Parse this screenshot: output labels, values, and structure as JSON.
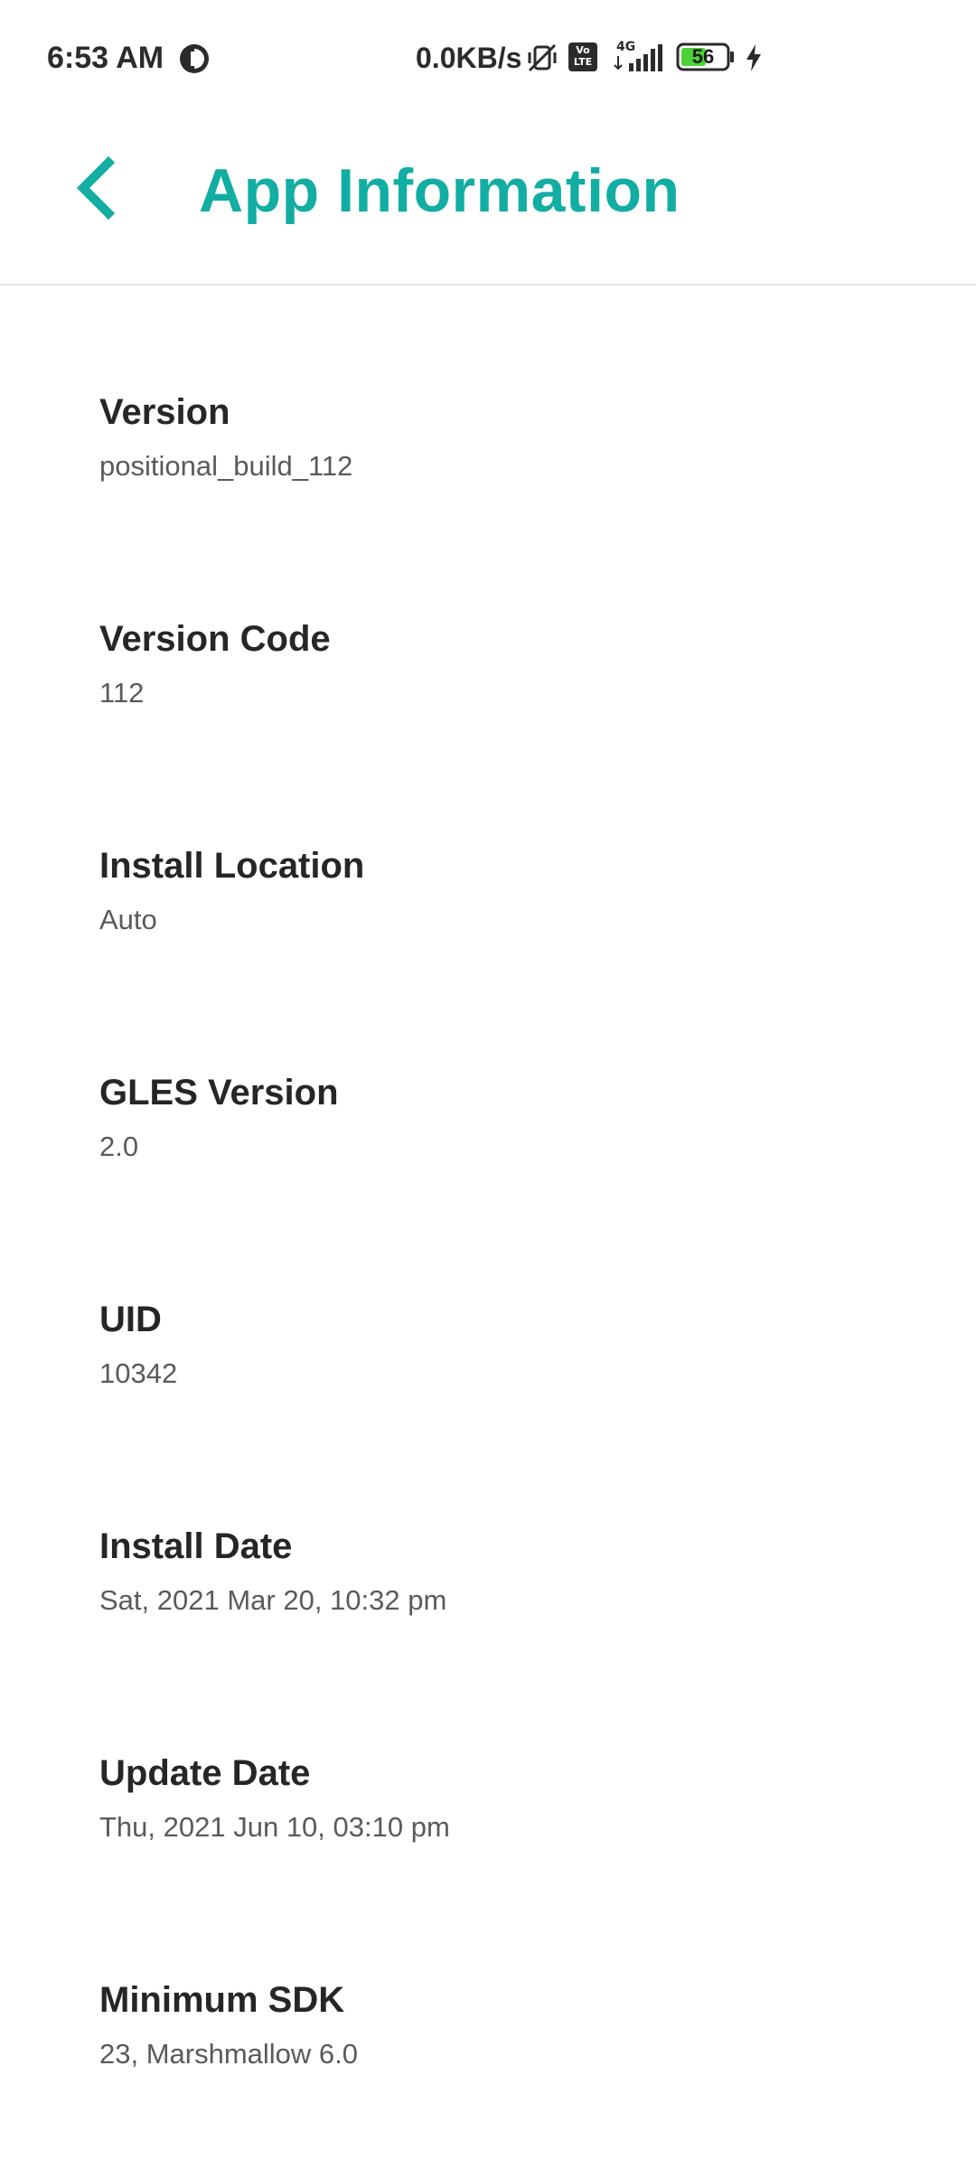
{
  "status_bar": {
    "time": "6:53 AM",
    "network_speed": "0.0KB/s",
    "volte_label": "Vo LTE",
    "network_type": "4G",
    "battery_level": "56",
    "icons": [
      "app-notification-icon",
      "vibrate-off-icon",
      "volte-icon",
      "signal-icon",
      "battery-icon",
      "charging-icon"
    ],
    "colors": {
      "battery_fill": "#4cd137"
    }
  },
  "header": {
    "title": "App Information",
    "back_icon": "chevron-left-icon"
  },
  "colors": {
    "accent": "#12ada3"
  },
  "info_items": [
    {
      "label": "Version",
      "value": "positional_build_112"
    },
    {
      "label": "Version Code",
      "value": "112"
    },
    {
      "label": "Install Location",
      "value": "Auto"
    },
    {
      "label": "GLES Version",
      "value": "2.0"
    },
    {
      "label": "UID",
      "value": "10342"
    },
    {
      "label": "Install Date",
      "value": "Sat, 2021 Mar 20, 10:32 pm"
    },
    {
      "label": "Update Date",
      "value": "Thu, 2021 Jun 10, 03:10 pm"
    },
    {
      "label": "Minimum SDK",
      "value": "23, Marshmallow 6.0"
    }
  ]
}
